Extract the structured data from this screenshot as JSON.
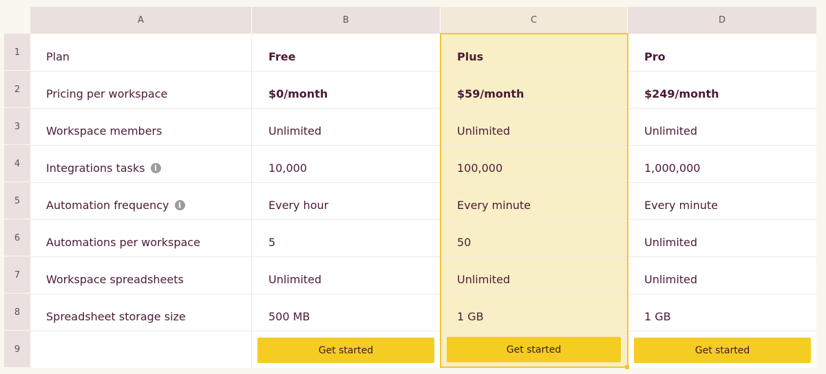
{
  "columns": [
    "A",
    "B",
    "C",
    "D"
  ],
  "rows": [
    "1",
    "2",
    "3",
    "4",
    "5",
    "6",
    "7",
    "8",
    "9"
  ],
  "table": {
    "labels": [
      "Plan",
      "Pricing per workspace",
      "Workspace members",
      "Integrations tasks",
      "Automation frequency",
      "Automations per workspace",
      "Workspace spreadsheets",
      "Spreadsheet storage size"
    ],
    "free": [
      "Free",
      "$0/month",
      "Unlimited",
      "10,000",
      "Every hour",
      "5",
      "Unlimited",
      "500 MB"
    ],
    "plus": [
      "Plus",
      "$59/month",
      "Unlimited",
      "100,000",
      "Every minute",
      "50",
      "Unlimited",
      "1 GB"
    ],
    "pro": [
      "Pro",
      "$249/month",
      "Unlimited",
      "1,000,000",
      "Every minute",
      "Unlimited",
      "Unlimited",
      "1 GB"
    ]
  },
  "info_icon_glyph": "i",
  "buttons": {
    "free": "Get started",
    "plus": "Get started",
    "pro": "Get started"
  },
  "colors": {
    "accent": "#f5cc22",
    "selection_border": "#f2c62e",
    "selection_fill": "#f9efc6",
    "header_bg": "#eae0dd",
    "text": "#4a1a36"
  }
}
